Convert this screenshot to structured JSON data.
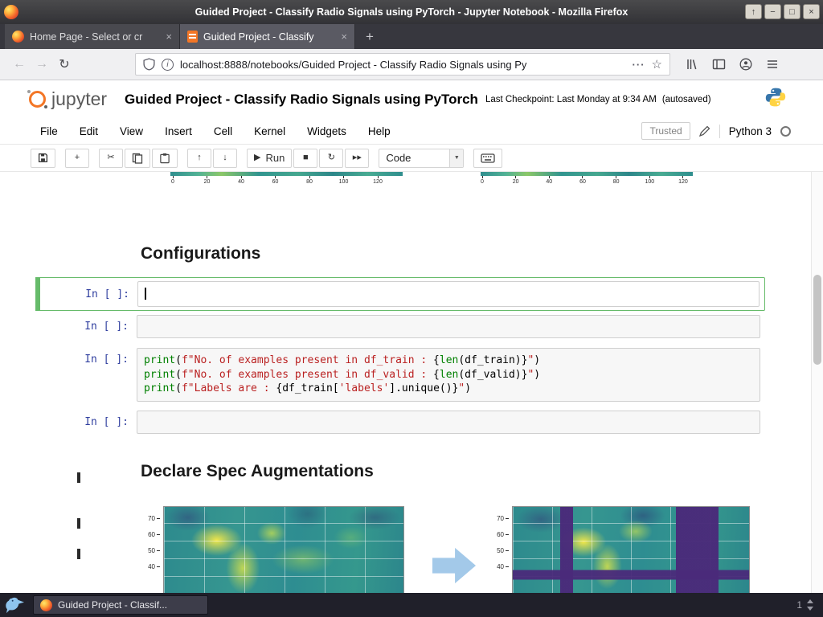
{
  "window": {
    "title": "Guided Project - Classify Radio Signals using PyTorch - Jupyter Notebook - Mozilla Firefox"
  },
  "icons": {
    "shade": "↑",
    "minimize": "−",
    "maximize": "□",
    "close": "×",
    "tab_close": "×",
    "new_tab": "+",
    "back": "←",
    "forward": "→",
    "reload": "↻",
    "page_actions": "···",
    "star": "☆",
    "info": "i",
    "add": "+",
    "cut": "✂",
    "up": "↑",
    "down": "↓",
    "run": "▶",
    "stop": "■",
    "restart": "↻",
    "fast_forward": "▸▸",
    "caret": "▼"
  },
  "tabs": {
    "home": "Home Page - Select or cr",
    "notebook": "Guided Project - Classify"
  },
  "navbar": {
    "url": "localhost:8888/notebooks/Guided Project - Classify Radio Signals using Py"
  },
  "header": {
    "logo": "jupyter",
    "title": "Guided Project - Classify Radio Signals using PyTorch",
    "checkpoint": "Last Checkpoint: Last Monday at 9:34 AM",
    "autosaved": "(autosaved)"
  },
  "menubar": {
    "menus": [
      "File",
      "Edit",
      "View",
      "Insert",
      "Cell",
      "Kernel",
      "Widgets",
      "Help"
    ],
    "trusted": "Trusted",
    "kernel": "Python 3"
  },
  "toolbar": {
    "run_label": "Run",
    "cell_type": "Code"
  },
  "notebook": {
    "axis_ticks": [
      "0",
      "20",
      "40",
      "60",
      "80",
      "100",
      "120"
    ],
    "heading_configurations": "Configurations",
    "prompt_empty": "In [ ]:",
    "code": {
      "lines": [
        [
          {
            "t": "print",
            "c": "b"
          },
          {
            "t": "(",
            "c": "p"
          },
          {
            "t": "f\"No. of examples present in df_train : ",
            "c": "s"
          },
          {
            "t": "{",
            "c": "p"
          },
          {
            "t": "len",
            "c": "b"
          },
          {
            "t": "(df_train)",
            "c": "p"
          },
          {
            "t": "}",
            "c": "p"
          },
          {
            "t": "\"",
            "c": "s"
          },
          {
            "t": ")",
            "c": "p"
          }
        ],
        [
          {
            "t": "print",
            "c": "b"
          },
          {
            "t": "(",
            "c": "p"
          },
          {
            "t": "f\"No. of examples present in df_valid : ",
            "c": "s"
          },
          {
            "t": "{",
            "c": "p"
          },
          {
            "t": "len",
            "c": "b"
          },
          {
            "t": "(df_valid)",
            "c": "p"
          },
          {
            "t": "}",
            "c": "p"
          },
          {
            "t": "\"",
            "c": "s"
          },
          {
            "t": ")",
            "c": "p"
          }
        ],
        [
          {
            "t": "print",
            "c": "b"
          },
          {
            "t": "(",
            "c": "p"
          },
          {
            "t": "f\"Labels are : ",
            "c": "s"
          },
          {
            "t": "{",
            "c": "p"
          },
          {
            "t": "df_train[",
            "c": "p"
          },
          {
            "t": "'labels'",
            "c": "s"
          },
          {
            "t": "].unique()}",
            "c": "p"
          },
          {
            "t": "\"",
            "c": "s"
          },
          {
            "t": ")",
            "c": "p"
          }
        ]
      ]
    },
    "heading_augmentations": "Declare Spec Augmentations",
    "spec_yticks": [
      "70",
      "60",
      "50",
      "40"
    ]
  },
  "taskbar": {
    "task_label": "Guided Project - Classif...",
    "workspace": "1"
  },
  "colors": {
    "accent_green": "#66bb6a",
    "prompt_blue": "#303f9f",
    "jupyter_orange": "#f37626",
    "string_red": "#ba2121",
    "builtin_green": "#008000"
  }
}
